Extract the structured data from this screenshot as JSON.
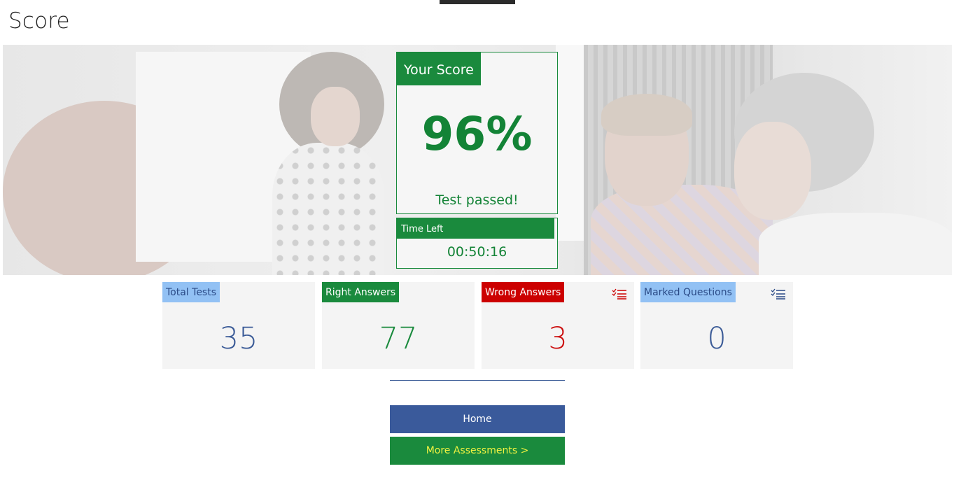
{
  "page": {
    "title": "Score"
  },
  "score": {
    "header": "Your Score",
    "value": "96%",
    "status": "Test passed!"
  },
  "time": {
    "header": "Time Left",
    "value": "00:50:16"
  },
  "stats": [
    {
      "label": "Total Tests",
      "value": "35"
    },
    {
      "label": "Right Answers",
      "value": "77"
    },
    {
      "label": "Wrong Answers",
      "value": "3",
      "icon": "checklist-icon"
    },
    {
      "label": "Marked Questions",
      "value": "0",
      "icon": "checklist-icon"
    }
  ],
  "buttons": {
    "home": "Home",
    "more": "More Assessments >"
  },
  "colors": {
    "green": "#1a8a3d",
    "blue": "#3a5a9b",
    "red": "#cc0000",
    "light_blue": "#92c1f4",
    "yellow_text": "#f1f240"
  }
}
